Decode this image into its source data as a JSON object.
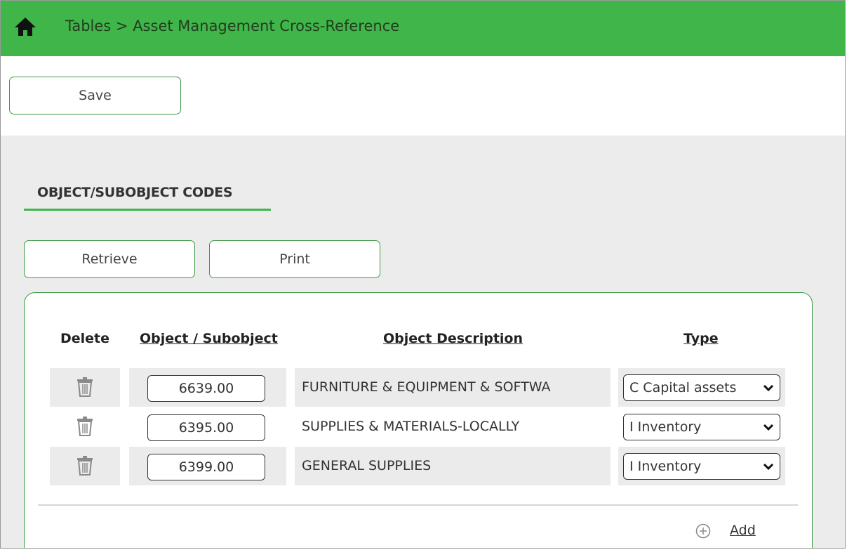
{
  "header": {
    "home_icon": "home-icon",
    "breadcrumb": "Tables > Asset Management Cross-Reference",
    "accent_color": "#3fb54a"
  },
  "toolbar": {
    "save_label": "Save"
  },
  "section": {
    "title": "OBJECT/SUBOBJECT CODES",
    "retrieve_label": "Retrieve",
    "print_label": "Print"
  },
  "table": {
    "headers": {
      "delete": "Delete",
      "object": "Object / Subobject",
      "description": "Object Description",
      "type": "Type"
    },
    "rows": [
      {
        "object": "6639.00",
        "description": "FURNITURE & EQUIPMENT & SOFTWA",
        "type": "C Capital assets"
      },
      {
        "object": "6395.00",
        "description": "SUPPLIES & MATERIALS-LOCALLY",
        "type": "I Inventory"
      },
      {
        "object": "6399.00",
        "description": "GENERAL SUPPLIES",
        "type": "I Inventory"
      }
    ],
    "add_label": "Add"
  }
}
